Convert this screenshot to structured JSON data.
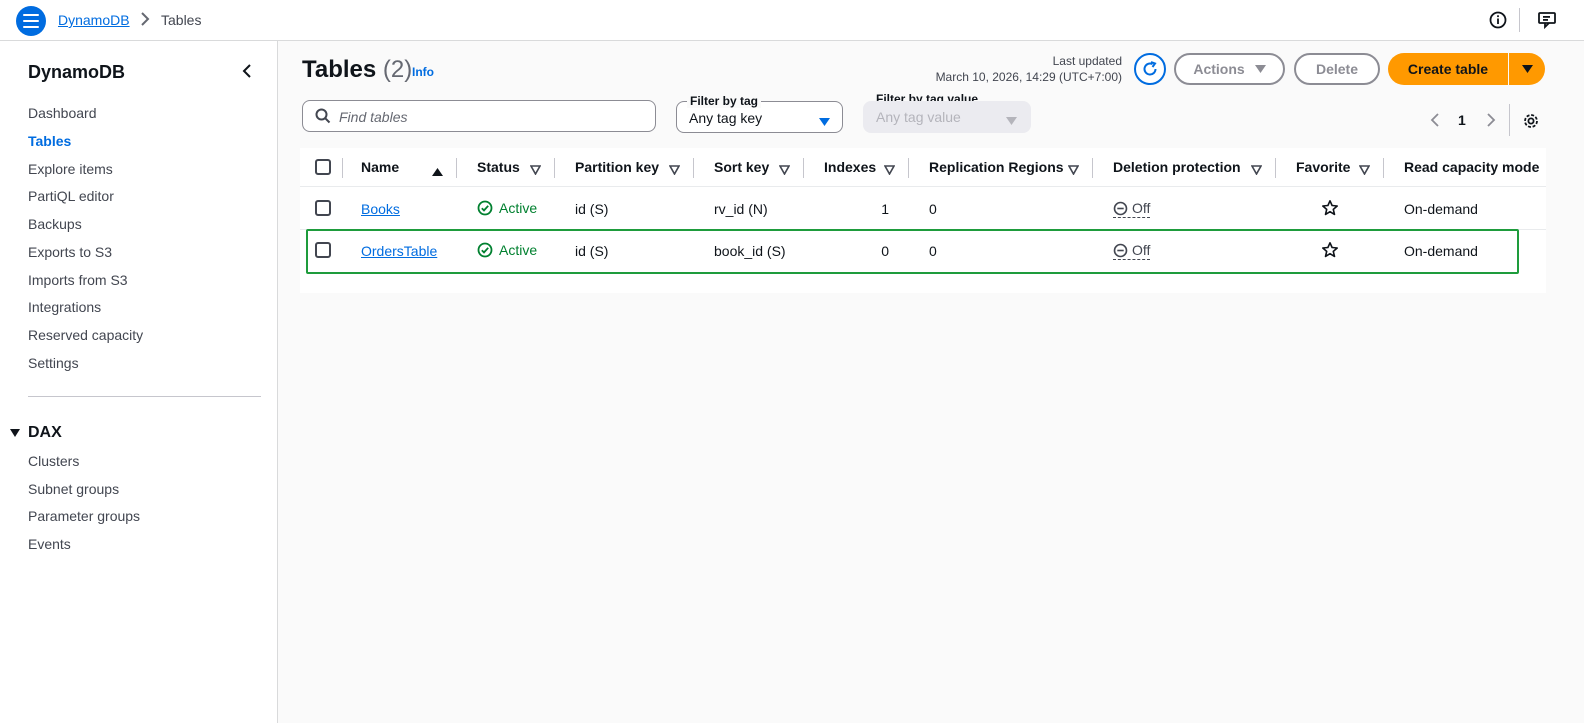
{
  "topbar": {
    "breadcrumb_service": "DynamoDB",
    "breadcrumb_current": "Tables",
    "icons": [
      "menu-icon",
      "chevron-right-icon",
      "info-icon",
      "feedback-icon"
    ]
  },
  "sidebar": {
    "title": "DynamoDB",
    "items": [
      {
        "label": "Dashboard",
        "active": false
      },
      {
        "label": "Tables",
        "active": true
      },
      {
        "label": "Explore items",
        "active": false
      },
      {
        "label": "PartiQL editor",
        "active": false
      },
      {
        "label": "Backups",
        "active": false
      },
      {
        "label": "Exports to S3",
        "active": false
      },
      {
        "label": "Imports from S3",
        "active": false
      },
      {
        "label": "Integrations",
        "active": false
      },
      {
        "label": "Reserved capacity",
        "active": false
      },
      {
        "label": "Settings",
        "active": false
      }
    ],
    "dax": {
      "label": "DAX",
      "items": [
        {
          "label": "Clusters"
        },
        {
          "label": "Subnet groups"
        },
        {
          "label": "Parameter groups"
        },
        {
          "label": "Events"
        }
      ]
    }
  },
  "header": {
    "title": "Tables",
    "count": "(2)",
    "info": "Info",
    "last_updated_label": "Last updated",
    "last_updated_value": "March 10, 2026, 14:29 (UTC+7:00)",
    "actions_label": "Actions",
    "delete_label": "Delete",
    "create_label": "Create table"
  },
  "filters": {
    "search_placeholder": "Find tables",
    "tag_label": "Filter by tag",
    "tag_value": "Any tag key",
    "tag_value_label": "Filter by tag value",
    "tag_value_placeholder": "Any tag value"
  },
  "pagination": {
    "current_page": "1"
  },
  "table": {
    "columns": [
      "Name",
      "Status",
      "Partition key",
      "Sort key",
      "Indexes",
      "Replication Regions",
      "Deletion protection",
      "Favorite",
      "Read capacity mode"
    ],
    "rows": [
      {
        "name": "Books",
        "status": "Active",
        "partition_key": "id (S)",
        "sort_key": "rv_id (N)",
        "indexes": "1",
        "replication_regions": "0",
        "deletion_protection": "Off",
        "read_capacity_mode": "On-demand"
      },
      {
        "name": "OrdersTable",
        "status": "Active",
        "partition_key": "id (S)",
        "sort_key": "book_id (S)",
        "indexes": "0",
        "replication_regions": "0",
        "deletion_protection": "Off",
        "read_capacity_mode": "On-demand"
      }
    ]
  },
  "colors": {
    "accent": "#006ce0",
    "primary_button": "#ff9900",
    "status_active": "#00802f",
    "row_highlight": "#1e9c3c"
  }
}
